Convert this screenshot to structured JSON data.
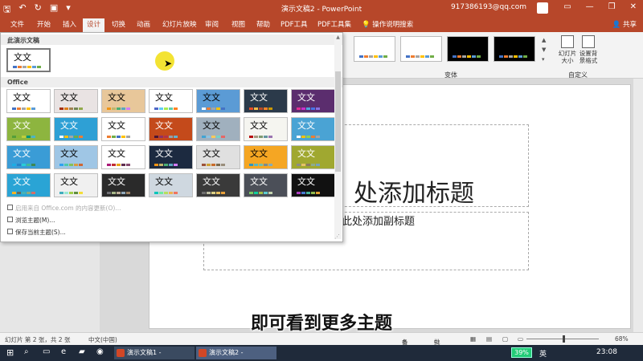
{
  "app": {
    "window_title": "演示文稿2 - PowerPoint",
    "account_email": "917386193@qq.com",
    "window_controls": [
      "—",
      "❐",
      "✕"
    ]
  },
  "ribbon_tabs": [
    {
      "label": "文件",
      "active": false
    },
    {
      "label": "开始",
      "active": false
    },
    {
      "label": "插入",
      "active": false
    },
    {
      "label": "设计",
      "active": true
    },
    {
      "label": "切换",
      "active": false
    },
    {
      "label": "动画",
      "active": false
    },
    {
      "label": "幻灯片放映",
      "active": false
    },
    {
      "label": "审阅",
      "active": false
    },
    {
      "label": "视图",
      "active": false
    },
    {
      "label": "帮助",
      "active": false
    },
    {
      "label": "PDF工具",
      "active": false
    },
    {
      "label": "PDF工具集",
      "active": false
    }
  ],
  "tell_me": "操作说明搜索",
  "share": "共享",
  "ribbon": {
    "variants_group_label": "变体",
    "customize_group_label": "自定义",
    "slide_size_label": "幻灯片大小",
    "format_background_label": "设置背景格式"
  },
  "theme_dropdown": {
    "this_presentation_label": "此演示文稿",
    "office_label": "Office",
    "sample_text": "文文",
    "more_from_office": "启用来自 Office.com 的内容更新(O)...",
    "browse_themes": "浏览主题(M)...",
    "save_theme": "保存当前主题(S)..."
  },
  "slide": {
    "title_placeholder": "单击此处添加标题",
    "title_visible": "处添加标题",
    "subtitle_visible": "此处添加副标题"
  },
  "caption": "即可看到更多主题",
  "status_bar": {
    "slide_info": "幻灯片 第 2 张，共 2 张",
    "language": "中文(中国)",
    "notes": "备注",
    "comments": "批注",
    "zoom": "68%"
  },
  "taskbar": {
    "items": [
      "演示文稿1 - PowerPo...",
      "演示文稿2 - PowerPo..."
    ],
    "battery": "39%",
    "ime": "英",
    "time": "23:08"
  },
  "colors": {
    "accent": "#b7472a",
    "ribbon_bg": "#f3f3f3",
    "taskbar_bg": "#1f2a3a"
  }
}
